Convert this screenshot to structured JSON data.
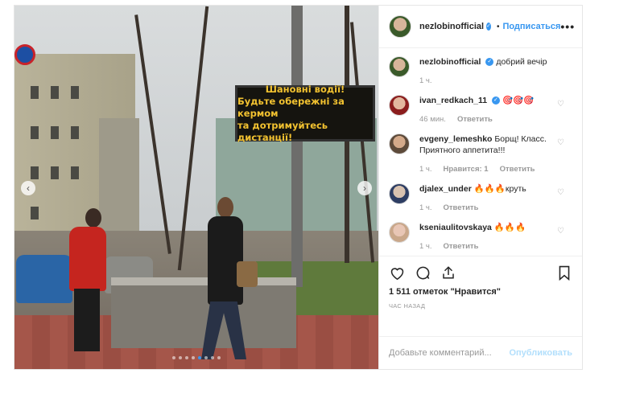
{
  "post": {
    "username": "nezlobinofficial",
    "follow_label": "Подписаться",
    "more_label": "•••",
    "sign_lines": [
      "Шановні водії!",
      "Будьте обережні за кермом",
      "та дотримуйтесь дистанції!"
    ],
    "prev_label": "‹",
    "next_label": "›",
    "carousel": {
      "count": 8,
      "active_index": 4
    }
  },
  "comments": [
    {
      "user": "nezlobinofficial",
      "text": "добрий вечір",
      "verified": true,
      "time": "1 ч.",
      "likes": "",
      "reply": ""
    },
    {
      "user": "ivan_redkach_11",
      "text": "🎯🎯🎯",
      "verified": true,
      "time": "46 мин.",
      "likes": "",
      "reply": "Ответить"
    },
    {
      "user": "evgeny_lemeshko",
      "text": "Борщ! Класс. Приятного аппетита!!!",
      "verified": false,
      "time": "1 ч.",
      "likes": "Нравится: 1",
      "reply": "Ответить"
    },
    {
      "user": "djalex_under",
      "text": "🔥🔥🔥круть",
      "verified": false,
      "time": "1 ч.",
      "likes": "",
      "reply": "Ответить"
    },
    {
      "user": "kseniaulitovskaya",
      "text": "🔥🔥🔥",
      "verified": false,
      "time": "1 ч.",
      "likes": "",
      "reply": "Ответить"
    }
  ],
  "footer": {
    "likes_text": "1 511 отметок \"Нравится\"",
    "time_ago": "ЧАС НАЗАД",
    "comment_placeholder": "Добавьте комментарий...",
    "publish_label": "Опубликовать"
  },
  "icons": [
    "heart-icon",
    "comment-icon",
    "share-icon",
    "bookmark-icon",
    "verified-icon"
  ],
  "colors": {
    "accent": "#3897f0",
    "sign_text": "#f2c230"
  }
}
